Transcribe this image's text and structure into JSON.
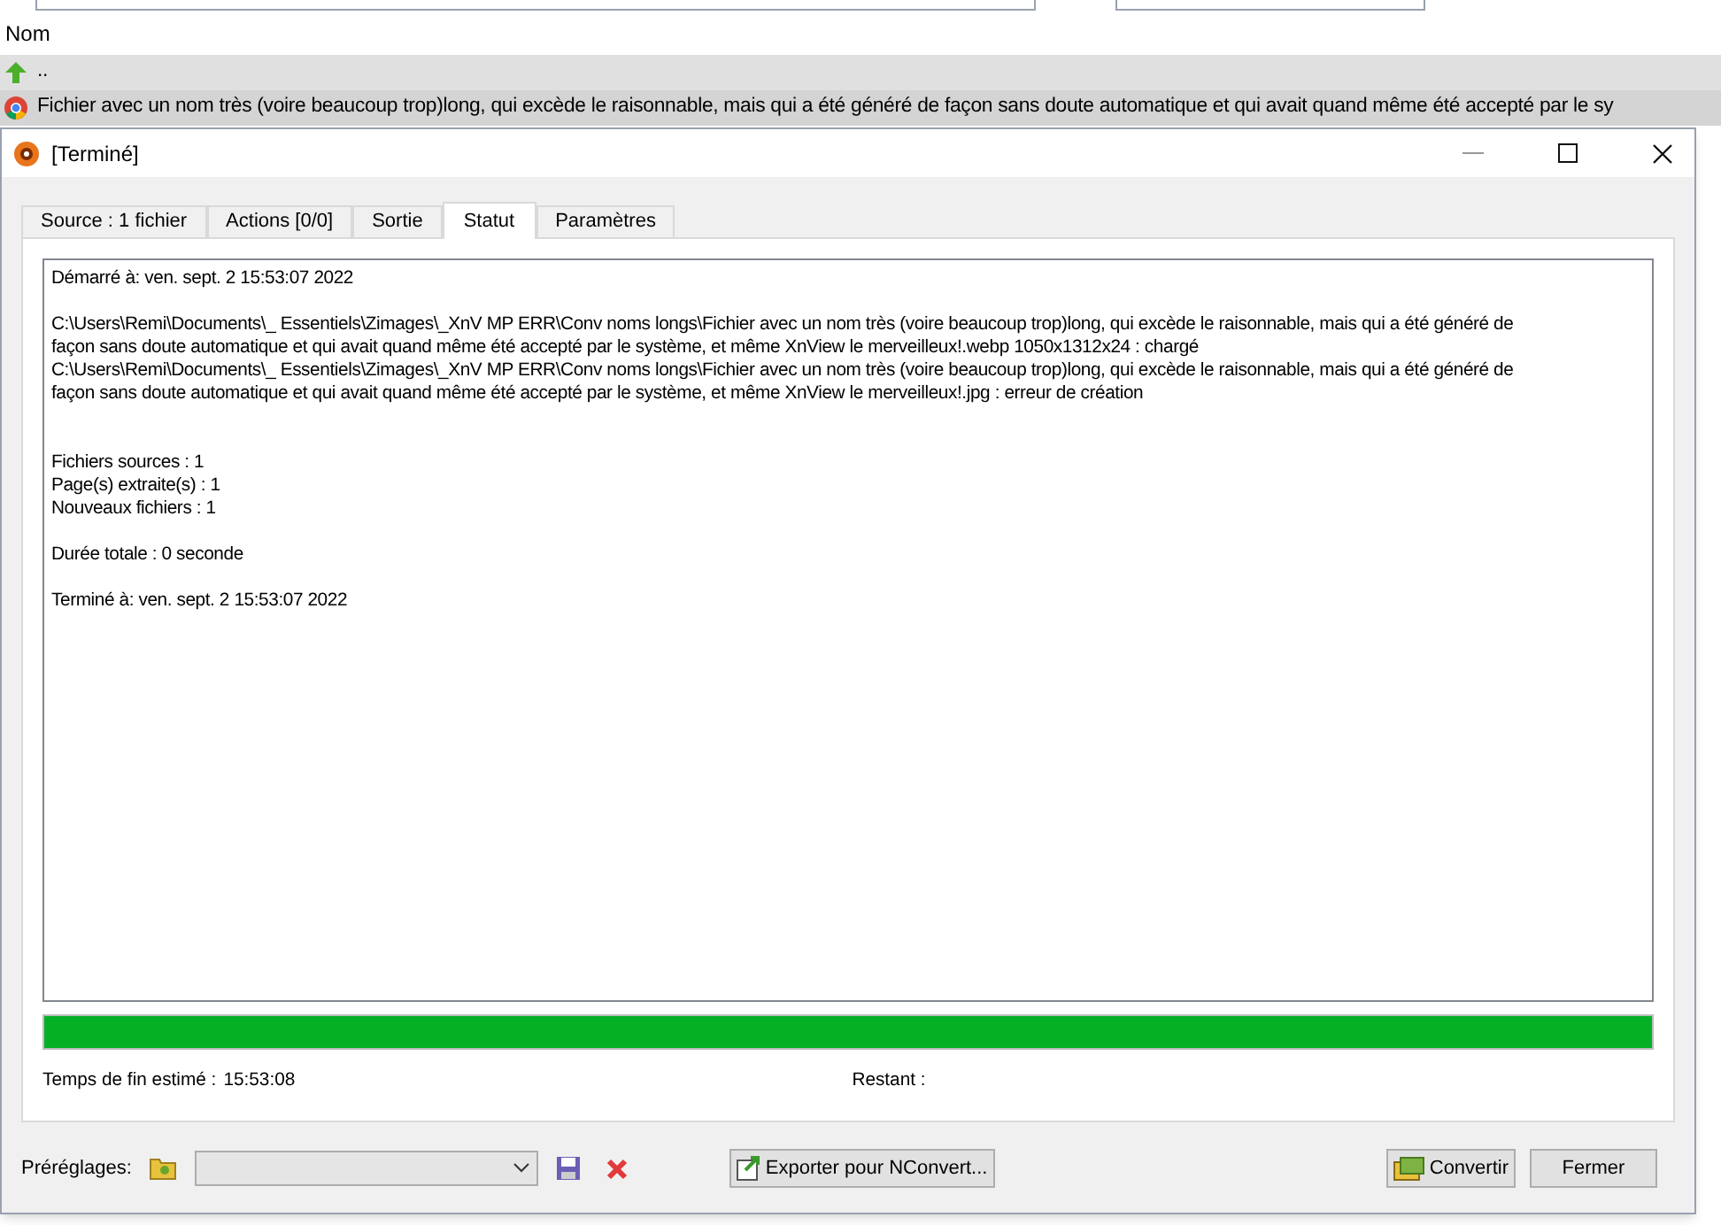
{
  "file_list": {
    "column_header": "Nom",
    "rows": [
      {
        "kind": "parent",
        "label": ".."
      },
      {
        "kind": "file",
        "label": "Fichier avec un nom très (voire beaucoup trop)long, qui excède le raisonnable, mais qui a été généré de façon sans doute automatique et qui avait quand même été accepté par le sy"
      }
    ]
  },
  "window": {
    "title": "[Terminé]"
  },
  "tabs": [
    {
      "label": "Source : 1 fichier",
      "selected": false
    },
    {
      "label": "Actions [0/0]",
      "selected": false
    },
    {
      "label": "Sortie",
      "selected": false
    },
    {
      "label": "Statut",
      "selected": true
    },
    {
      "label": "Paramètres",
      "selected": false
    }
  ],
  "log": [
    [
      "Démarré à: ven. sept. 2 15:53:07 2022"
    ],
    [
      "C:\\Users\\Remi\\Documents\\_ Essentiels\\Zimages\\_XnV MP ERR\\Conv noms longs\\Fichier avec un nom très (voire beaucoup trop)long, qui excède le raisonnable, mais qui a été généré de",
      "façon sans doute automatique et qui avait quand même été accepté par le système, et même XnView le merveilleux!.webp 1050x1312x24 : chargé",
      "C:\\Users\\Remi\\Documents\\_ Essentiels\\Zimages\\_XnV MP ERR\\Conv noms longs\\Fichier avec un nom très (voire beaucoup trop)long, qui excède le raisonnable, mais qui a été généré de",
      "façon sans doute automatique et qui avait quand même été accepté par le système, et même XnView le merveilleux!.jpg : erreur de création"
    ],
    [
      "Fichiers sources : 1",
      "Page(s) extraite(s) : 1",
      "Nouveaux fichiers : 1"
    ],
    [
      "Durée totale : 0 seconde"
    ],
    [
      "Terminé à: ven. sept. 2 15:53:07 2022"
    ]
  ],
  "progress": {
    "level": 1
  },
  "estimated_end": {
    "label": "Temps de fin estimé :",
    "value": "15:53:08"
  },
  "remaining": {
    "label": "Restant :"
  },
  "presets": {
    "label": "Préréglages:"
  },
  "buttons": {
    "export": "Exporter pour NConvert...",
    "convert": "Convertir",
    "close": "Fermer"
  }
}
